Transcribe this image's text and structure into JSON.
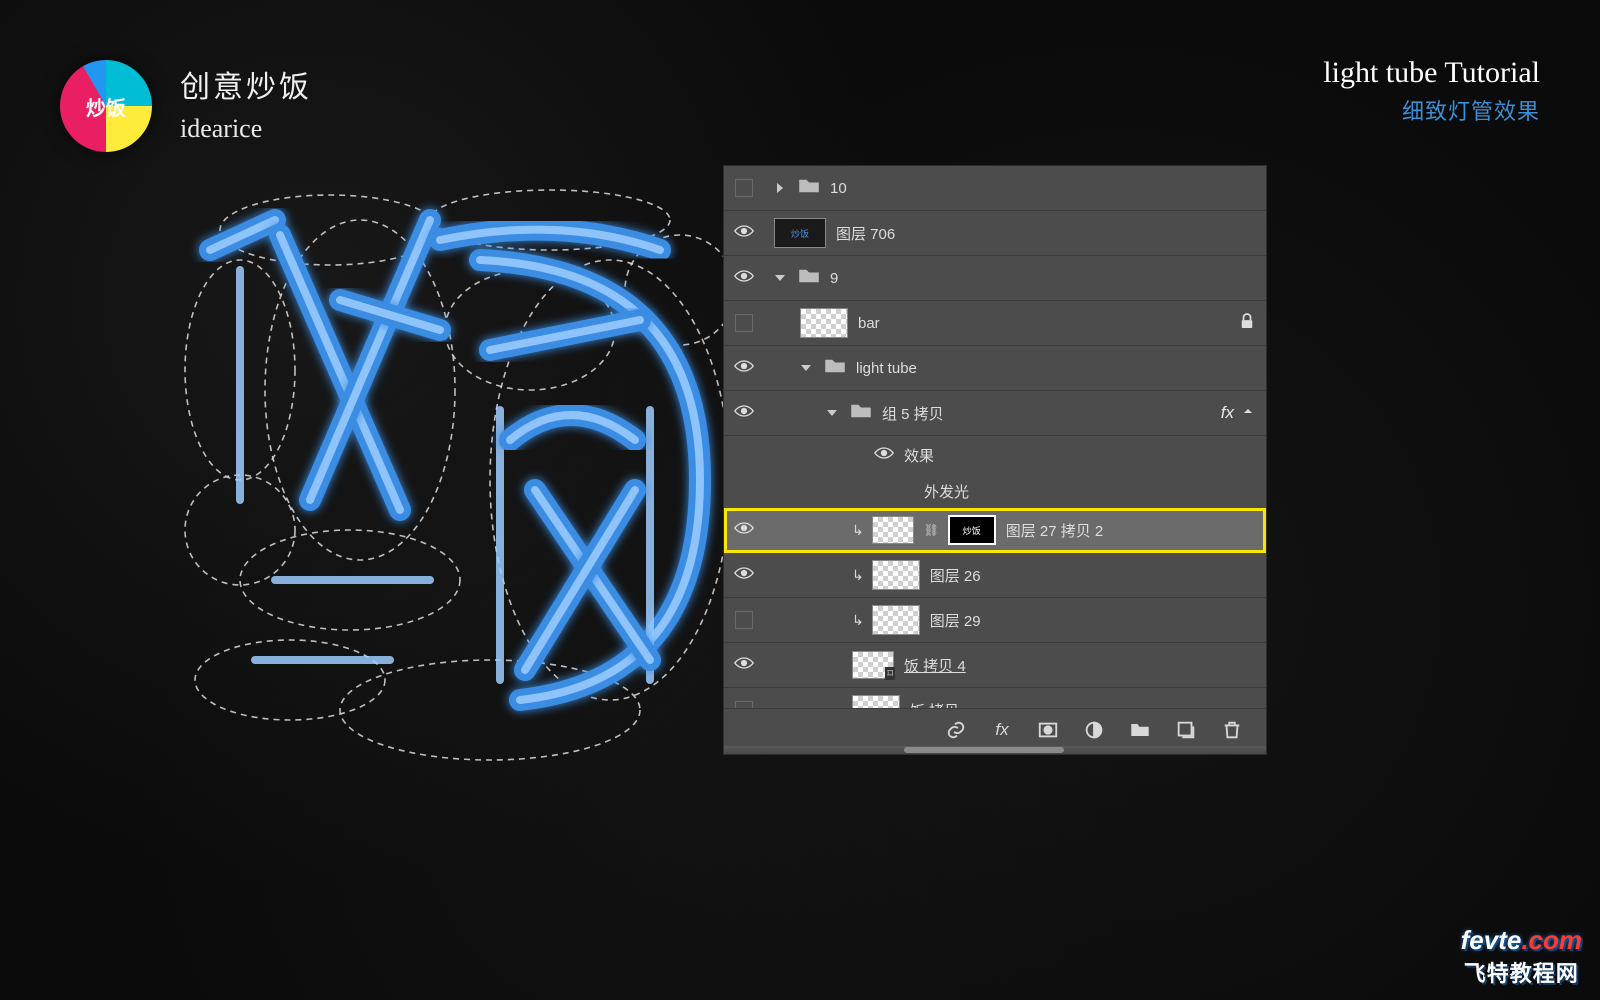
{
  "brand": {
    "cn": "创意炒饭",
    "en": "idearice",
    "badge": "炒饭"
  },
  "title": {
    "en": "light tube Tutorial",
    "cn": "细致灯管效果"
  },
  "panel": {
    "rows": [
      {
        "kind": "folder",
        "visible": false,
        "open": false,
        "indent": 0,
        "label": "10"
      },
      {
        "kind": "layer",
        "visible": true,
        "indent": 0,
        "thumb": "dark",
        "label": "图层 706"
      },
      {
        "kind": "folder",
        "visible": true,
        "open": true,
        "indent": 0,
        "label": "9"
      },
      {
        "kind": "layer",
        "visible": false,
        "indent": 1,
        "thumb": "checker",
        "label": "bar",
        "locked": true
      },
      {
        "kind": "folder",
        "visible": true,
        "open": true,
        "indent": 1,
        "label": "light tube"
      },
      {
        "kind": "folder",
        "visible": true,
        "open": true,
        "indent": 2,
        "label": "组 5 拷贝",
        "fx": true
      },
      {
        "kind": "effects-header",
        "indent": 3,
        "label": "效果"
      },
      {
        "kind": "effects-item",
        "indent": 4,
        "label": "外发光"
      },
      {
        "kind": "masked-layer",
        "visible": true,
        "indent": 3,
        "clip": true,
        "label": "图层 27 拷贝 2",
        "selected": true,
        "highlighted": true
      },
      {
        "kind": "layer",
        "visible": true,
        "indent": 3,
        "clip": true,
        "thumb": "checker",
        "label": "图层 26"
      },
      {
        "kind": "layer",
        "visible": false,
        "indent": 3,
        "clip": true,
        "thumb": "checker",
        "label": "图层 29"
      },
      {
        "kind": "smart-layer",
        "visible": true,
        "indent": 3,
        "label": "饭 拷贝 4",
        "underline": true
      },
      {
        "kind": "layer",
        "visible": false,
        "indent": 3,
        "thumb": "checker",
        "label": "饭 拷贝"
      }
    ],
    "footer_icons": [
      "link",
      "fx",
      "mask",
      "adjust",
      "group",
      "new",
      "trash"
    ]
  },
  "watermark": {
    "line1a": "fevte",
    "line1b": ".com",
    "line2": "飞特教程网"
  }
}
